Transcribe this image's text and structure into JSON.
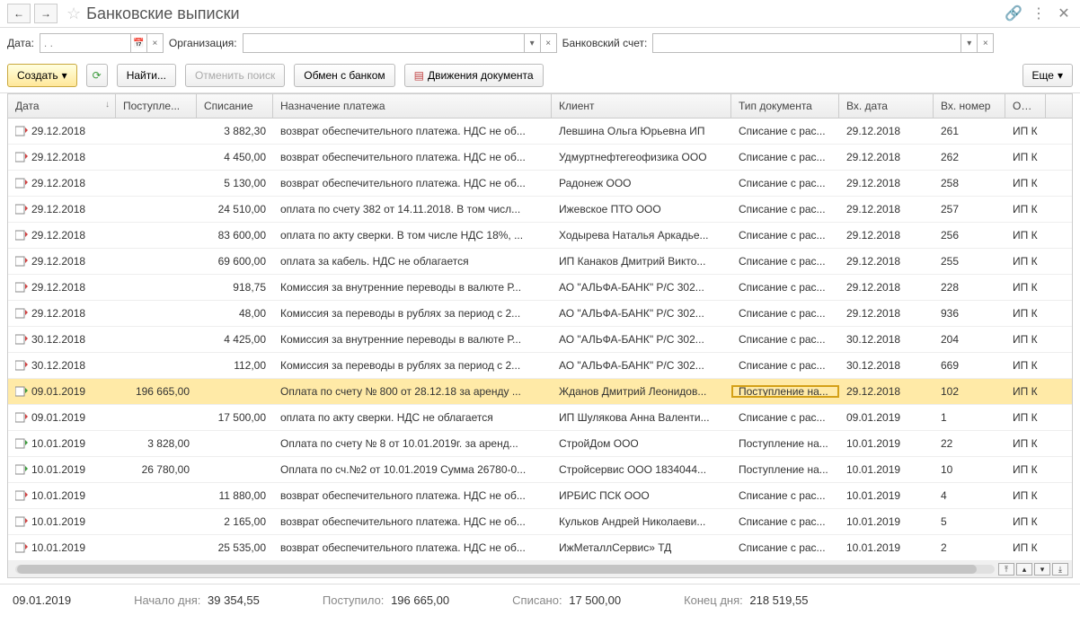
{
  "header": {
    "title": "Банковские выписки"
  },
  "filters": {
    "date_label": "Дата:",
    "date_placeholder": ".   .",
    "org_label": "Организация:",
    "bank_label": "Банковский счет:"
  },
  "toolbar": {
    "create": "Создать",
    "find": "Найти...",
    "cancel_search": "Отменить поиск",
    "exchange": "Обмен с банком",
    "movements": "Движения документа",
    "more": "Еще"
  },
  "columns": {
    "date": "Дата",
    "income": "Поступле...",
    "outcome": "Списание",
    "purpose": "Назначение платежа",
    "client": "Клиент",
    "doctype": "Тип документа",
    "indate": "Вх. дата",
    "innum": "Вх. номер",
    "org": "Орган"
  },
  "rows": [
    {
      "dir": "out",
      "date": "29.12.2018",
      "in": "",
      "out": "3 882,30",
      "purpose": "возврат обеспечительного платежа. НДС не об...",
      "client": "Левшина Ольга Юрьевна ИП",
      "doctype": "Списание с рас...",
      "indate": "29.12.2018",
      "innum": "261",
      "org": "ИП К"
    },
    {
      "dir": "out",
      "date": "29.12.2018",
      "in": "",
      "out": "4 450,00",
      "purpose": "возврат обеспечительного платежа. НДС не об...",
      "client": "Удмуртнефтегеофизика ООО",
      "doctype": "Списание с рас...",
      "indate": "29.12.2018",
      "innum": "262",
      "org": "ИП К"
    },
    {
      "dir": "out",
      "date": "29.12.2018",
      "in": "",
      "out": "5 130,00",
      "purpose": "возврат обеспечительного платежа. НДС не об...",
      "client": "Радонеж ООО",
      "doctype": "Списание с рас...",
      "indate": "29.12.2018",
      "innum": "258",
      "org": "ИП К"
    },
    {
      "dir": "out",
      "date": "29.12.2018",
      "in": "",
      "out": "24 510,00",
      "purpose": "оплата по счету 382 от 14.11.2018. В том числ...",
      "client": "Ижевское ПТО ООО",
      "doctype": "Списание с рас...",
      "indate": "29.12.2018",
      "innum": "257",
      "org": "ИП К"
    },
    {
      "dir": "out",
      "date": "29.12.2018",
      "in": "",
      "out": "83 600,00",
      "purpose": "оплата по акту сверки. В том числе НДС 18%, ...",
      "client": "Ходырева Наталья Аркадье...",
      "doctype": "Списание с рас...",
      "indate": "29.12.2018",
      "innum": "256",
      "org": "ИП К"
    },
    {
      "dir": "out",
      "date": "29.12.2018",
      "in": "",
      "out": "69 600,00",
      "purpose": "оплата за кабель. НДС не облагается",
      "client": "ИП Канаков Дмитрий Викто...",
      "doctype": "Списание с рас...",
      "indate": "29.12.2018",
      "innum": "255",
      "org": "ИП К"
    },
    {
      "dir": "out",
      "date": "29.12.2018",
      "in": "",
      "out": "918,75",
      "purpose": "Комиссия за внутренние переводы в валюте Р...",
      "client": "АО \"АЛЬФА-БАНК\" Р/С 302...",
      "doctype": "Списание с рас...",
      "indate": "29.12.2018",
      "innum": "228",
      "org": "ИП К"
    },
    {
      "dir": "out",
      "date": "29.12.2018",
      "in": "",
      "out": "48,00",
      "purpose": "Комиссия за переводы в рублях за период с 2...",
      "client": "АО \"АЛЬФА-БАНК\" Р/С 302...",
      "doctype": "Списание с рас...",
      "indate": "29.12.2018",
      "innum": "936",
      "org": "ИП К"
    },
    {
      "dir": "out",
      "date": "30.12.2018",
      "in": "",
      "out": "4 425,00",
      "purpose": "Комиссия за внутренние переводы в валюте Р...",
      "client": "АО \"АЛЬФА-БАНК\" Р/С 302...",
      "doctype": "Списание с рас...",
      "indate": "30.12.2018",
      "innum": "204",
      "org": "ИП К"
    },
    {
      "dir": "out",
      "date": "30.12.2018",
      "in": "",
      "out": "112,00",
      "purpose": "Комиссия за переводы в рублях за период с 2...",
      "client": "АО \"АЛЬФА-БАНК\" Р/С 302...",
      "doctype": "Списание с рас...",
      "indate": "30.12.2018",
      "innum": "669",
      "org": "ИП К"
    },
    {
      "dir": "in",
      "date": "09.01.2019",
      "in": "196 665,00",
      "out": "",
      "purpose": "Оплата по счету № 800 от 28.12.18 за аренду ...",
      "client": "Жданов Дмитрий Леонидов...",
      "doctype": "Поступление на...",
      "indate": "29.12.2018",
      "innum": "102",
      "org": "ИП К",
      "selected": true
    },
    {
      "dir": "out",
      "date": "09.01.2019",
      "in": "",
      "out": "17 500,00",
      "purpose": "оплата по акту сверки. НДС не облагается",
      "client": "ИП Шулякова Анна Валенти...",
      "doctype": "Списание с рас...",
      "indate": "09.01.2019",
      "innum": "1",
      "org": "ИП К"
    },
    {
      "dir": "in",
      "date": "10.01.2019",
      "in": "3 828,00",
      "out": "",
      "purpose": "Оплата по счету № 8 от 10.01.2019г. за аренд...",
      "client": "СтройДом ООО",
      "doctype": "Поступление на...",
      "indate": "10.01.2019",
      "innum": "22",
      "org": "ИП К"
    },
    {
      "dir": "in",
      "date": "10.01.2019",
      "in": "26 780,00",
      "out": "",
      "purpose": "Оплата по сч.№2 от 10.01.2019 Сумма 26780-0...",
      "client": "Стройсервис ООО 1834044...",
      "doctype": "Поступление на...",
      "indate": "10.01.2019",
      "innum": "10",
      "org": "ИП К"
    },
    {
      "dir": "out",
      "date": "10.01.2019",
      "in": "",
      "out": "11 880,00",
      "purpose": "возврат обеспечительного платежа. НДС не об...",
      "client": "ИРБИС ПСК ООО",
      "doctype": "Списание с рас...",
      "indate": "10.01.2019",
      "innum": "4",
      "org": "ИП К"
    },
    {
      "dir": "out",
      "date": "10.01.2019",
      "in": "",
      "out": "2 165,00",
      "purpose": "возврат обеспечительного платежа. НДС не об...",
      "client": "Кульков Андрей Николаеви...",
      "doctype": "Списание с рас...",
      "indate": "10.01.2019",
      "innum": "5",
      "org": "ИП К"
    },
    {
      "dir": "out",
      "date": "10.01.2019",
      "in": "",
      "out": "25 535,00",
      "purpose": "возврат обеспечительного платежа. НДС не об...",
      "client": "ИжМеталлСервис» ТД",
      "doctype": "Списание с рас...",
      "indate": "10.01.2019",
      "innum": "2",
      "org": "ИП К"
    }
  ],
  "status": {
    "date": "09.01.2019",
    "start_label": "Начало дня:",
    "start_value": "39 354,55",
    "in_label": "Поступило:",
    "in_value": "196 665,00",
    "out_label": "Списано:",
    "out_value": "17 500,00",
    "end_label": "Конец дня:",
    "end_value": "218 519,55"
  }
}
